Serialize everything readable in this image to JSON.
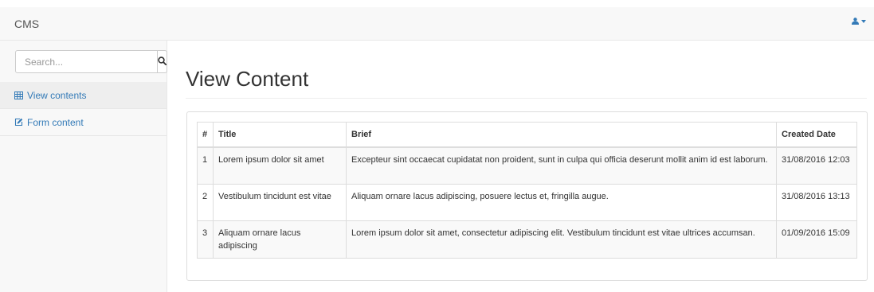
{
  "navbar": {
    "brand": "CMS"
  },
  "sidebar": {
    "search": {
      "placeholder": "Search..."
    },
    "items": [
      {
        "label": "View contents",
        "icon": "table-icon",
        "active": true
      },
      {
        "label": "Form content",
        "icon": "edit-icon",
        "active": false
      }
    ]
  },
  "main": {
    "title": "View Content",
    "table": {
      "headers": [
        "#",
        "Title",
        "Brief",
        "Created Date"
      ],
      "rows": [
        {
          "num": "1",
          "title": "Lorem ipsum dolor sit amet",
          "brief": "Excepteur sint occaecat cupidatat non proident, sunt in culpa qui officia deserunt mollit anim id est laborum.",
          "created": "31/08/2016 12:03"
        },
        {
          "num": "2",
          "title": "Vestibulum tincidunt est vitae",
          "brief": "Aliquam ornare lacus adipiscing, posuere lectus et, fringilla augue.",
          "created": "31/08/2016 13:13"
        },
        {
          "num": "3",
          "title": "Aliquam ornare lacus adipiscing",
          "brief": "Lorem ipsum dolor sit amet, consectetur adipiscing elit. Vestibulum tincidunt est vitae ultrices accumsan.",
          "created": "01/09/2016 15:09"
        }
      ]
    }
  },
  "colors": {
    "link": "#337ab7",
    "navbar_bg": "#f8f8f8",
    "border": "#dddddd"
  }
}
